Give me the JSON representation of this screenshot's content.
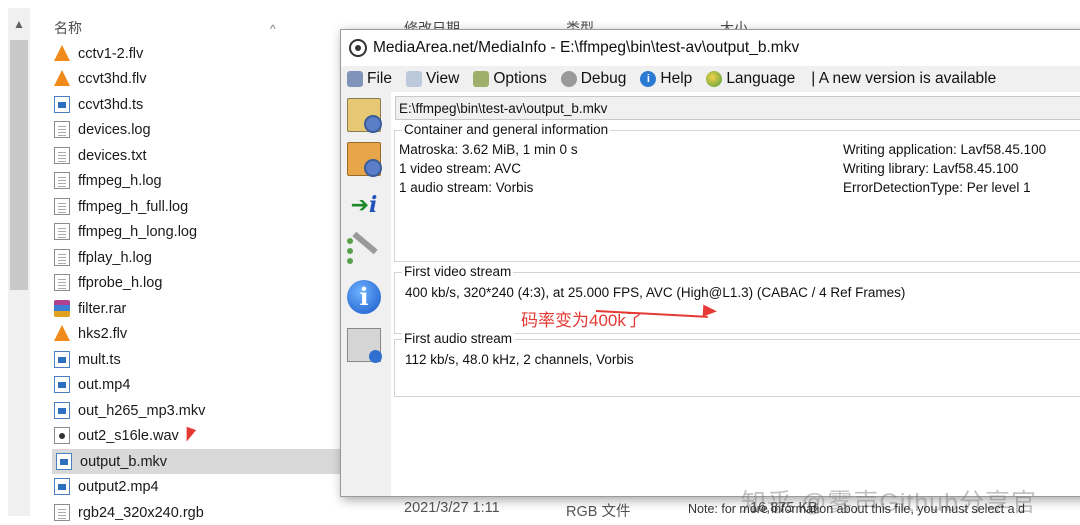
{
  "explorer": {
    "columns": {
      "name": "名称",
      "modified": "修改日期",
      "type": "类型",
      "size": "大小"
    },
    "files": [
      {
        "name": "cctv1-2.flv",
        "icon": "vlc-icon"
      },
      {
        "name": "ccvt3hd.flv",
        "icon": "vlc-icon"
      },
      {
        "name": "ccvt3hd.ts",
        "icon": "media-file-icon"
      },
      {
        "name": "devices.log",
        "icon": "text-file-icon"
      },
      {
        "name": "devices.txt",
        "icon": "text-file-icon"
      },
      {
        "name": "ffmpeg_h.log",
        "icon": "text-file-icon"
      },
      {
        "name": "ffmpeg_h_full.log",
        "icon": "text-file-icon"
      },
      {
        "name": "ffmpeg_h_long.log",
        "icon": "text-file-icon"
      },
      {
        "name": "ffplay_h.log",
        "icon": "text-file-icon"
      },
      {
        "name": "ffprobe_h.log",
        "icon": "text-file-icon"
      },
      {
        "name": "filter.rar",
        "icon": "rar-archive-icon"
      },
      {
        "name": "hks2.flv",
        "icon": "vlc-icon"
      },
      {
        "name": "mult.ts",
        "icon": "media-file-icon"
      },
      {
        "name": "out.mp4",
        "icon": "media-file-icon"
      },
      {
        "name": "out_h265_mp3.mkv",
        "icon": "media-file-icon"
      },
      {
        "name": "out2_s16le.wav",
        "icon": "audio-file-icon"
      },
      {
        "name": "output_b.mkv",
        "icon": "media-file-icon",
        "selected": true
      },
      {
        "name": "output2.mp4",
        "icon": "media-file-icon"
      },
      {
        "name": "rgb24_320x240.rgb",
        "icon": "text-file-icon"
      }
    ],
    "last_row": {
      "modified": "2021/3/27 1:11",
      "type": "RGB 文件",
      "size": "16,875 KB"
    }
  },
  "mediainfo": {
    "title": "MediaArea.net/MediaInfo - E:\\ffmpeg\\bin\\test-av\\output_b.mkv",
    "menu": {
      "file": "File",
      "view": "View",
      "options": "Options",
      "debug": "Debug",
      "help": "Help",
      "language": "Language",
      "new_version": "| A new version is available"
    },
    "path": "E:\\ffmpeg\\bin\\test-av\\output_b.mkv",
    "general": {
      "heading": "Container and general information",
      "left": [
        "Matroska: 3.62 MiB, 1 min 0 s",
        "1 video stream: AVC",
        "1 audio stream: Vorbis"
      ],
      "right": [
        "Writing application: Lavf58.45.100",
        "Writing library: Lavf58.45.100",
        "ErrorDetectionType: Per level 1"
      ]
    },
    "video": {
      "heading": "First video stream",
      "info": "400 kb/s, 320*240 (4:3), at 25.000 FPS, AVC (High@L1.3) (CABAC / 4 Ref Frames)"
    },
    "audio": {
      "heading": "First audio stream",
      "info": "112 kb/s, 48.0 kHz, 2 channels, Vorbis"
    },
    "annotation": "码率变为400k了",
    "note": "Note: for more information about this file, you must select a d",
    "watermark": "知乎 @雾声Github分享官"
  },
  "colors": {
    "annotation_red": "#e53935",
    "selected_row": "#d9d9d9"
  }
}
